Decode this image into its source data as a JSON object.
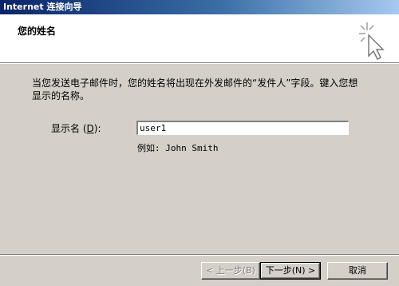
{
  "window": {
    "title": "Internet 连接向导"
  },
  "header": {
    "title": "您的姓名",
    "icon": "wizard-sparkle-cursor-icon"
  },
  "description": "当您发送电子邮件时，您的姓名将出现在外发邮件的“发件人”字段。键入您想显示的名称。",
  "form": {
    "display_name_label": "显示名",
    "display_name_hotkey": "D",
    "display_name_label_suffix": "):",
    "display_name_value": "user1",
    "example": "例如: John Smith"
  },
  "buttons": {
    "back": "< 上一步(B)",
    "next": "下一步(N) >",
    "cancel": "取消"
  },
  "colors": {
    "face": "#d4d0c8",
    "title_start": "#0a246a",
    "title_end": "#a6caf0",
    "header_bg": "#ffffff"
  }
}
